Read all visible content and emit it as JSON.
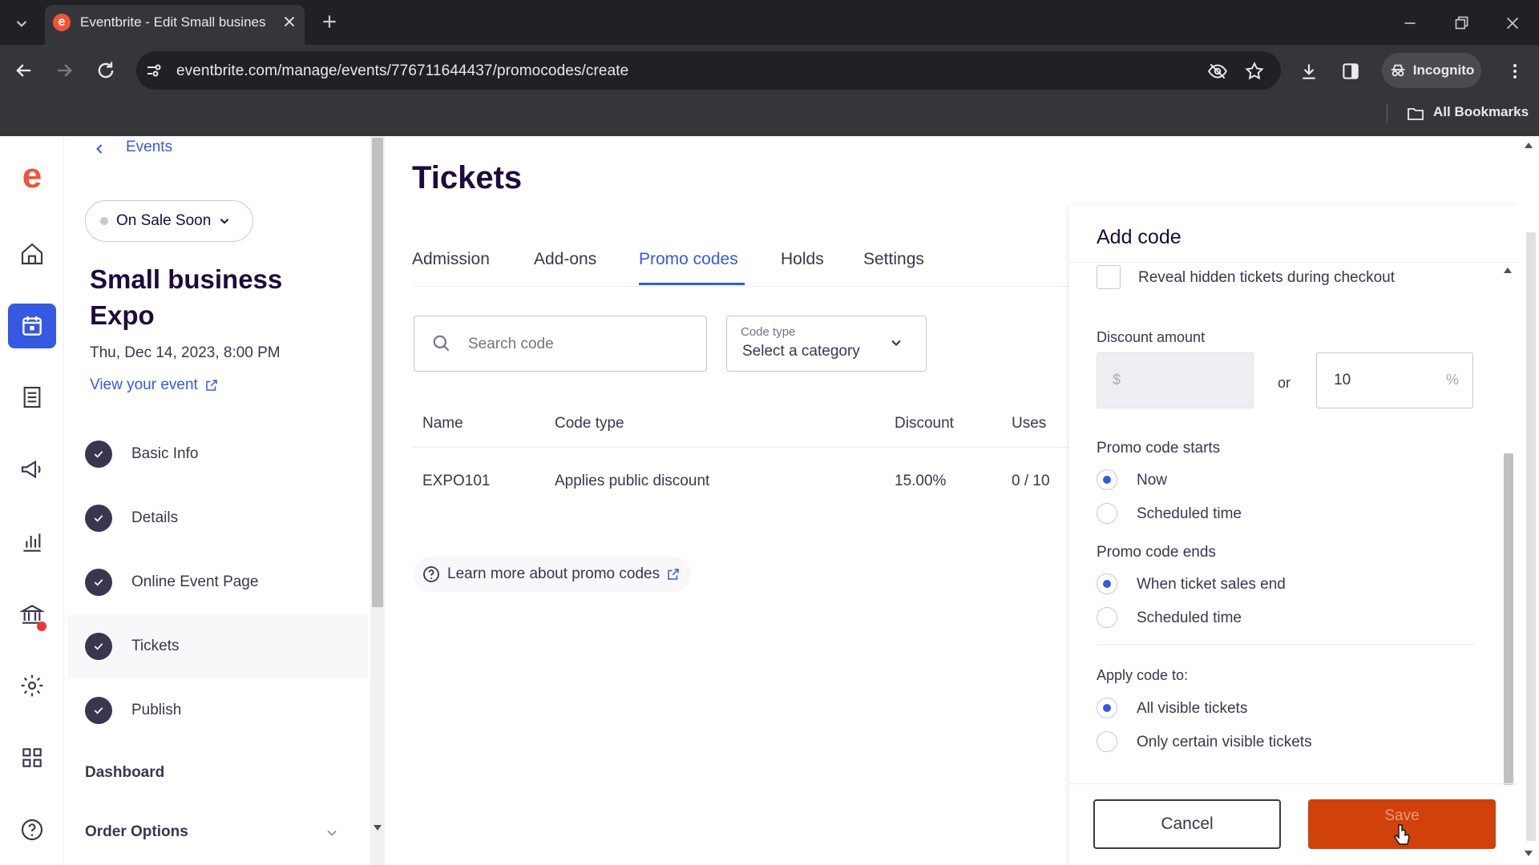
{
  "browser": {
    "tab_title": "Eventbrite - Edit Small busines",
    "url": "eventbrite.com/manage/events/776711644437/promocodes/create",
    "incognito_label": "Incognito",
    "bookmarks_label": "All Bookmarks"
  },
  "sidebar": {
    "back_label": "Events",
    "status_label": "On Sale Soon",
    "event_title_line1": "Small business",
    "event_title_line2": "Expo",
    "event_date": "Thu, Dec 14, 2023, 8:00 PM",
    "view_event_label": "View your event",
    "steps": [
      {
        "label": "Basic Info"
      },
      {
        "label": "Details"
      },
      {
        "label": "Online Event Page"
      },
      {
        "label": "Tickets"
      },
      {
        "label": "Publish"
      }
    ],
    "dashboard_label": "Dashboard",
    "order_options_label": "Order Options"
  },
  "main": {
    "title": "Tickets",
    "tabs": [
      "Admission",
      "Add-ons",
      "Promo codes",
      "Holds",
      "Settings"
    ],
    "active_tab": "Promo codes",
    "search_placeholder": "Search code",
    "code_type_label": "Code type",
    "code_type_value": "Select a category",
    "table": {
      "headers": [
        "Name",
        "Code type",
        "Discount",
        "Uses"
      ],
      "rows": [
        {
          "name": "EXPO101",
          "code_type": "Applies public discount",
          "discount": "15.00%",
          "uses": "0 / 10"
        }
      ]
    },
    "learn_more_label": "Learn more about promo codes"
  },
  "panel": {
    "title": "Add code",
    "reveal_label": "Reveal hidden tickets during checkout",
    "discount_label": "Discount amount",
    "dollar_symbol": "$",
    "or_label": "or",
    "percent_value": "10",
    "percent_symbol": "%",
    "starts_label": "Promo code starts",
    "starts_options": [
      "Now",
      "Scheduled time"
    ],
    "ends_label": "Promo code ends",
    "ends_options": [
      "When ticket sales end",
      "Scheduled time"
    ],
    "apply_label": "Apply code to:",
    "apply_options": [
      "All visible tickets",
      "Only certain visible tickets"
    ],
    "cancel_label": "Cancel",
    "save_label": "Save"
  },
  "colors": {
    "brand_orange": "#d1410c",
    "accent_blue": "#3659e3",
    "text_dark": "#1e0a3c"
  }
}
